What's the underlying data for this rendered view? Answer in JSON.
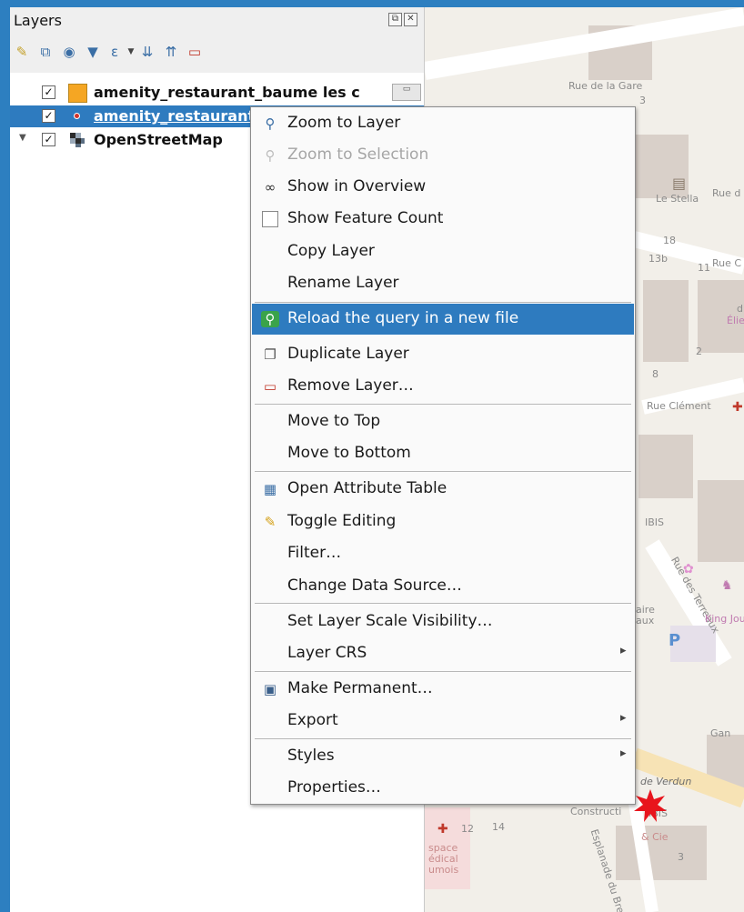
{
  "panel": {
    "title": "Layers",
    "toolbar_icons": [
      "open-layer-styling-icon",
      "add-group-icon",
      "manage-map-themes-icon",
      "filter-legend-icon",
      "filter-by-expression-icon",
      "expand-all-icon",
      "collapse-all-icon",
      "remove-layer-icon"
    ]
  },
  "layers": [
    {
      "name": "amenity_restaurant_baume les c",
      "checked": "✓",
      "symbol": "orange-fill-symbol",
      "color": "#f5a623"
    },
    {
      "name": "amenity_restaurant",
      "checked": "✓",
      "symbol": "red-point-symbol",
      "color": "#d0342c"
    },
    {
      "name": "OpenStreetMap",
      "checked": "✓",
      "symbol": "raster-tile-symbol",
      "expander": "▼"
    }
  ],
  "context_menu": {
    "items": [
      {
        "label": "Zoom to Layer",
        "icon": "zoom-to-layer-icon"
      },
      {
        "label": "Zoom to Selection",
        "icon": "zoom-to-selection-icon",
        "disabled": true
      },
      {
        "label": "Show in Overview",
        "icon": "overview-icon"
      },
      {
        "label": "Show Feature Count",
        "checkbox": true
      },
      {
        "label": "Copy Layer"
      },
      {
        "label": "Rename Layer"
      },
      {
        "label": "Reload the query in a new file",
        "icon": "reload-query-icon",
        "active": true
      },
      {
        "label": "Duplicate Layer",
        "icon": "duplicate-layer-icon"
      },
      {
        "label": "Remove Layer…",
        "icon": "remove-layer-icon"
      },
      {
        "label": "Move to Top"
      },
      {
        "label": "Move to Bottom"
      },
      {
        "label": "Open Attribute Table",
        "icon": "attribute-table-icon"
      },
      {
        "label": "Toggle Editing",
        "icon": "pencil-icon"
      },
      {
        "label": "Filter…"
      },
      {
        "label": "Change Data Source…"
      },
      {
        "label": "Set Layer Scale Visibility…"
      },
      {
        "label": "Layer CRS",
        "submenu": true
      },
      {
        "label": "Make Permanent…",
        "icon": "save-icon"
      },
      {
        "label": "Export",
        "submenu": true
      },
      {
        "label": "Styles",
        "submenu": true
      },
      {
        "label": "Properties…"
      }
    ],
    "submenu_arrow": "▸"
  },
  "map_labels": {
    "l1": "Rue de la Gare",
    "l2": "Le Stella",
    "l3": "Rue d",
    "l4": "Rue C",
    "l5": "Rue Clément",
    "l6": "Rue des Terreaux",
    "l7": "King Jou",
    "l8": "de Verdun",
    "l9": "Constructi",
    "l10": "Esplanade du Breuil",
    "l11": "space",
    "l12": "édical",
    "l13": "umois",
    "l14": "Gan",
    "l15": "IBIS",
    "l16": "& Cie",
    "l17": "IBIS",
    "l18": "aire",
    "l19": "aux",
    "n1": "3",
    "n2": "18",
    "n3": "13b",
    "n4": "11",
    "n5": "2",
    "n6": "8",
    "n7": "14",
    "n8": "12",
    "n9": "3",
    "n10": "d",
    "n11": "Élie"
  },
  "colors": {
    "accent": "#2e7bbf",
    "desktop": "#2d7fc0",
    "map_bg": "#f2efe9",
    "building": "#d9d0c9",
    "road": "#ffffff",
    "marker": "#e8141c"
  }
}
